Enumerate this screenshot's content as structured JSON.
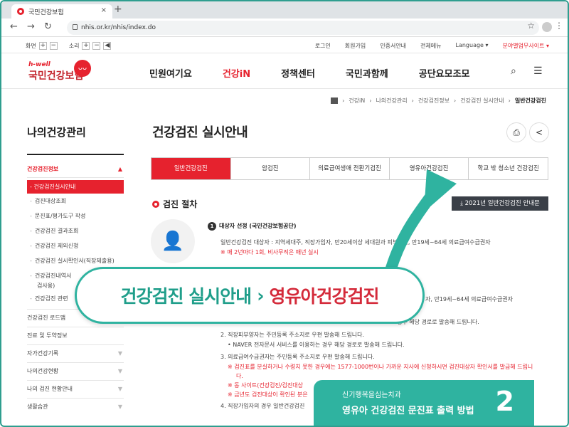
{
  "browser": {
    "tab_title": "국민건강보험",
    "tab_close": "×",
    "new_tab": "+",
    "url": "nhis.or.kr/nhis/index.do",
    "back": "←",
    "forward": "→",
    "reload": "↻",
    "bookmark": "☆",
    "menu": "⋮"
  },
  "util": {
    "screen_label": "화면",
    "sound_label": "소리",
    "plus": "+",
    "minus": "−",
    "speaker": "◀",
    "links": [
      "로그인",
      "회원가입",
      "인증서안내",
      "전체메뉴",
      "Language ▾"
    ],
    "site_link": "분야별업무사이트 ▾"
  },
  "logo": {
    "hwell": "h-well",
    "name": "국민건강보험",
    "mark": "ᴗᴗ"
  },
  "gnb": {
    "items": [
      "민원여기요",
      "건강iN",
      "정책센터",
      "국민과함께",
      "공단요모조모"
    ],
    "search": "⌕",
    "menu": "☰"
  },
  "breadcrumb": {
    "items": [
      "건강iN",
      "나의건강관리",
      "건강검진정보",
      "건강검진 실시안내"
    ],
    "current": "일반건강검진",
    "sep": "›"
  },
  "sidebar": {
    "title": "나의건강관리",
    "section": "건강검진정보",
    "open_arrow": "▲",
    "closed_arrow": "▼",
    "active": "-  건강검진실시안내",
    "subs": [
      "검진대상조회",
      "문진표/평가도구 작성",
      "건강검진 결과조회",
      "건강검진 제외신청",
      "건강검진 실시확인서(직장제출용)",
      "건강검진내역서",
      "검사용)",
      "건강검진 관련"
    ],
    "bullet": "-",
    "menus": [
      "건강검진 로드맵",
      "진료 및 투약정보",
      "자가건강기록",
      "나의건강현황",
      "나의 검진 현황안내",
      "생활습관"
    ]
  },
  "main": {
    "title": "건강검진 실시안내",
    "print_icon": "⎙",
    "share_icon": "<",
    "tabs": [
      "일반건강검진",
      "암검진",
      "의료급여생애 전환기검진",
      "영유아건강검진",
      "학교 밖 청소년 건강검진"
    ],
    "section": "검진 절차",
    "download": "⤓ 2021년 일반건강검진 안내문",
    "person_icon": "👤",
    "step1_no": "1",
    "step1_title": "대상자 선정 (국민건강보험공단)",
    "step1_l1": "일반건강검진 대상자 : 지역세대주, 직장가입자, 만20세이상 세대원과 피부양자, 만19세~64세 의료급여수급권자",
    "step1_l2": "※ 매 2년마다 1회, 비사무직은 매년 실시",
    "right1": "자, 만19세~64세 의료급여수급권자",
    "right2": "경우 해당 경로로 발송해 드립니다.",
    "l2": "2. 직장피부양자는 주민등록 주소지로 우편 발송해 드립니다.",
    "l3": "• NAVER 전자문서 서비스를 이용하는 경우 해당 경로로 발송해 드립니다.",
    "l4": "3. 의료급여수급권자는 주민등록 주소지로 우편 발송해 드립니다.",
    "l5": "※ 검진표를 분실하거나 수령치 못한 경우에는 1577-1000번이나 가까운 지사에 신청하시면 검진대상자 확인서를 발급해 드립니",
    "l6": "다.",
    "l7": "※ 동 사이트(건강검진/검진대상",
    "l8": "※ 금년도 검진대상이 확인된 분은",
    "l9": "4. 직장가입자의 경우 일반건강검진"
  },
  "overlay": {
    "banner_part1": "건강검진 실시안내",
    "banner_arrow": "›",
    "banner_part2": "영유아건강검진",
    "badge_sub": "신기행복을심는치과",
    "badge_title": "영유아 건강검진 문진표 출력 방법",
    "badge_num": "2",
    "accent": "#2fb3a0",
    "brand_red": "#e6222e"
  }
}
